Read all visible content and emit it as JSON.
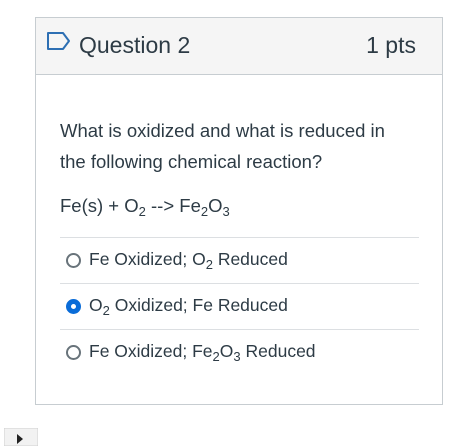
{
  "question": {
    "title": "Question 2",
    "points": "1 pts",
    "text": "What is oxidized and what is reduced in the following chemical reaction?"
  },
  "equation": {
    "fe": "Fe(s) + O",
    "o_sub": "2",
    "arrow": " --> Fe",
    "fe_sub": "2",
    "o": "O",
    "o3_sub": "3"
  },
  "answers": [
    {
      "parts": [
        "Fe Oxidized; O",
        "2",
        " Reduced"
      ],
      "selected": false
    },
    {
      "parts": [
        "O",
        "2",
        " Oxidized; Fe Reduced"
      ],
      "selected": true
    },
    {
      "parts": [
        "Fe Oxidized; Fe",
        "2",
        "O",
        "3",
        " Reduced"
      ],
      "selected": false
    }
  ],
  "colors": {
    "accent": "#0a6cd8",
    "text": "#2d3b45",
    "header_bg": "#f5f5f5",
    "border": "#c7cdd1"
  },
  "icons": {
    "flag": "bookmark-flag-icon",
    "cursor": "pointer-cursor-icon"
  }
}
